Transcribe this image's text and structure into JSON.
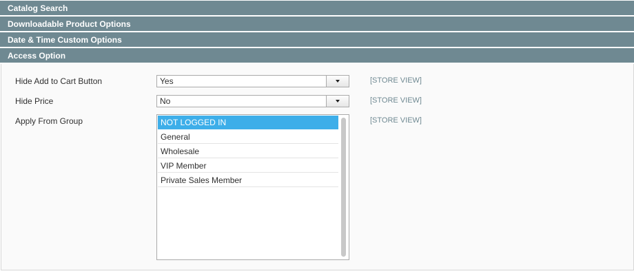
{
  "sections": [
    {
      "title": "Catalog Search"
    },
    {
      "title": "Downloadable Product Options"
    },
    {
      "title": "Date & Time Custom Options"
    },
    {
      "title": "Access Option"
    }
  ],
  "fields": {
    "hide_add_to_cart": {
      "label": "Hide Add to Cart Button",
      "value": "Yes",
      "scope": "[STORE VIEW]"
    },
    "hide_price": {
      "label": "Hide Price",
      "value": "No",
      "scope": "[STORE VIEW]"
    },
    "apply_from_group": {
      "label": "Apply From Group",
      "scope": "[STORE VIEW]",
      "options": [
        "NOT LOGGED IN",
        "General",
        "Wholesale",
        "VIP Member",
        "Private Sales Member"
      ],
      "selected": "NOT LOGGED IN"
    }
  },
  "icons": {
    "dropdown": "chevron-down-icon"
  },
  "colors": {
    "header_bg": "#6f8992",
    "selected_bg": "#3daee9",
    "scope_text": "#6f8992"
  }
}
